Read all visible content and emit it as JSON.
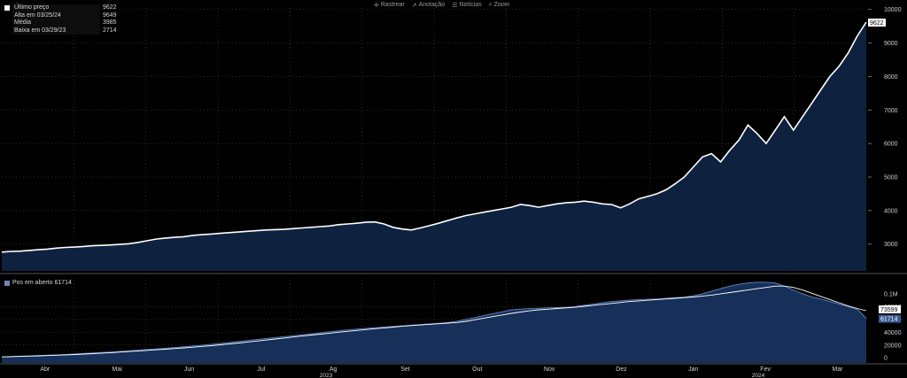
{
  "toolbar": {
    "items": [
      {
        "icon": "crosshair-icon",
        "label": "Rastrear"
      },
      {
        "icon": "annotation-icon",
        "label": "Anotação"
      },
      {
        "icon": "news-icon",
        "label": "Notícias"
      },
      {
        "icon": "zoom-icon",
        "label": "Zoom"
      }
    ]
  },
  "legend": [
    {
      "label": "Último preço",
      "value": "9622",
      "color": "#ffffff"
    },
    {
      "label": "Alta em 03/25/24",
      "value": "9649",
      "color": "#ffffff"
    },
    {
      "label": "Média",
      "value": "3985",
      "color": "#ffffff"
    },
    {
      "label": "Baixa em 03/29/23",
      "value": "2714",
      "color": "#ffffff"
    }
  ],
  "legend2": {
    "label": "Pos em aberto 61714",
    "color": "#6f87b5"
  },
  "colors": {
    "area": "#0e2240",
    "line": "#ffffff",
    "oi_area": "#16305a",
    "oi_line": "#ffffff",
    "grid": "#3a3a3a",
    "badge_bg": "#3a5a90"
  },
  "chart_data": [
    {
      "type": "area",
      "ylim": [
        2200,
        10150
      ],
      "yticks": [
        3000,
        4000,
        5000,
        6000,
        7000,
        8000,
        9000,
        10000
      ],
      "last_label": "9622",
      "series": [
        {
          "name": "Último preço",
          "values": [
            2760,
            2780,
            2790,
            2810,
            2830,
            2850,
            2880,
            2900,
            2910,
            2930,
            2950,
            2960,
            2975,
            2990,
            3010,
            3050,
            3100,
            3150,
            3180,
            3200,
            3220,
            3260,
            3280,
            3300,
            3320,
            3340,
            3360,
            3380,
            3400,
            3420,
            3430,
            3440,
            3460,
            3480,
            3500,
            3520,
            3540,
            3580,
            3600,
            3620,
            3650,
            3660,
            3600,
            3500,
            3450,
            3420,
            3480,
            3550,
            3620,
            3700,
            3780,
            3850,
            3900,
            3950,
            4000,
            4050,
            4100,
            4180,
            4150,
            4100,
            4150,
            4200,
            4230,
            4250,
            4280,
            4250,
            4200,
            4180,
            4080,
            4200,
            4350,
            4420,
            4500,
            4620,
            4800,
            5000,
            5300,
            5600,
            5700,
            5450,
            5800,
            6100,
            6550,
            6300,
            6000,
            6400,
            6800,
            6400,
            6800,
            7200,
            7600,
            8000,
            8300,
            8700,
            9200,
            9622
          ]
        }
      ]
    },
    {
      "type": "area",
      "ylim": [
        -8000,
        122000
      ],
      "yticks": [
        0,
        20000,
        40000,
        60000,
        80000
      ],
      "ytick_labels": [
        "0",
        "20000",
        "40000",
        "60000",
        "80000",
        "0.1M"
      ],
      "top_label": "0.1M",
      "badges": [
        "73599",
        "61714"
      ],
      "series": [
        {
          "name": "Pos em aberto",
          "values": [
            1500,
            2000,
            2500,
            3000,
            3500,
            4000,
            4600,
            5200,
            6000,
            6800,
            7600,
            8400,
            9200,
            10000,
            11000,
            12000,
            13000,
            14000,
            15000,
            16000,
            17200,
            18400,
            19600,
            21000,
            22500,
            24000,
            25500,
            27000,
            28500,
            30000,
            31500,
            33000,
            34500,
            36000,
            37500,
            39000,
            40500,
            42000,
            43500,
            45000,
            46000,
            47000,
            48000,
            49000,
            50000,
            51000,
            52000,
            53000,
            54000,
            55000,
            57000,
            60000,
            63000,
            66000,
            69000,
            72000,
            75000,
            76000,
            77000,
            77500,
            78000,
            78500,
            79000,
            80000,
            82000,
            84000,
            86000,
            88000,
            89000,
            90000,
            91000,
            91500,
            92000,
            93000,
            94000,
            95000,
            97000,
            100000,
            104000,
            108000,
            112000,
            115000,
            117000,
            118000,
            118000,
            117000,
            112000,
            106000,
            100000,
            95000,
            92000,
            88000,
            84000,
            80000,
            76000,
            61714
          ]
        },
        {
          "values": [
            1400,
            1800,
            2200,
            2600,
            3000,
            3500,
            4000,
            4600,
            5200,
            5800,
            6500,
            7300,
            8100,
            9000,
            9900,
            10800,
            11700,
            12600,
            13500,
            14500,
            15500,
            16600,
            17800,
            19000,
            20300,
            21700,
            23100,
            24600,
            26100,
            27700,
            29300,
            30900,
            32500,
            34000,
            35500,
            37000,
            38500,
            40000,
            41400,
            42800,
            44200,
            45500,
            46800,
            48000,
            49200,
            50300,
            51300,
            52300,
            53300,
            54200,
            55200,
            57000,
            59500,
            62000,
            64500,
            67000,
            69500,
            71500,
            73500,
            75000,
            76000,
            77000,
            78000,
            79000,
            80500,
            82000,
            83500,
            85000,
            86500,
            88000,
            89000,
            90000,
            91000,
            92000,
            93000,
            94000,
            95000,
            96500,
            98000,
            100000,
            102000,
            104000,
            106000,
            108000,
            110000,
            112000,
            112000,
            110000,
            106000,
            101000,
            96000,
            91000,
            86000,
            81000,
            77000,
            73599
          ]
        }
      ]
    },
    {
      "type": "line",
      "x_tick_labels": [
        "Abr",
        "Mai",
        "Jun",
        "Jul",
        "Ag",
        "Set",
        "Out",
        "Nov",
        "Dez",
        "Jan",
        "Fev",
        "Mar"
      ],
      "x_year_labels": [
        "2023",
        "2024"
      ]
    }
  ]
}
